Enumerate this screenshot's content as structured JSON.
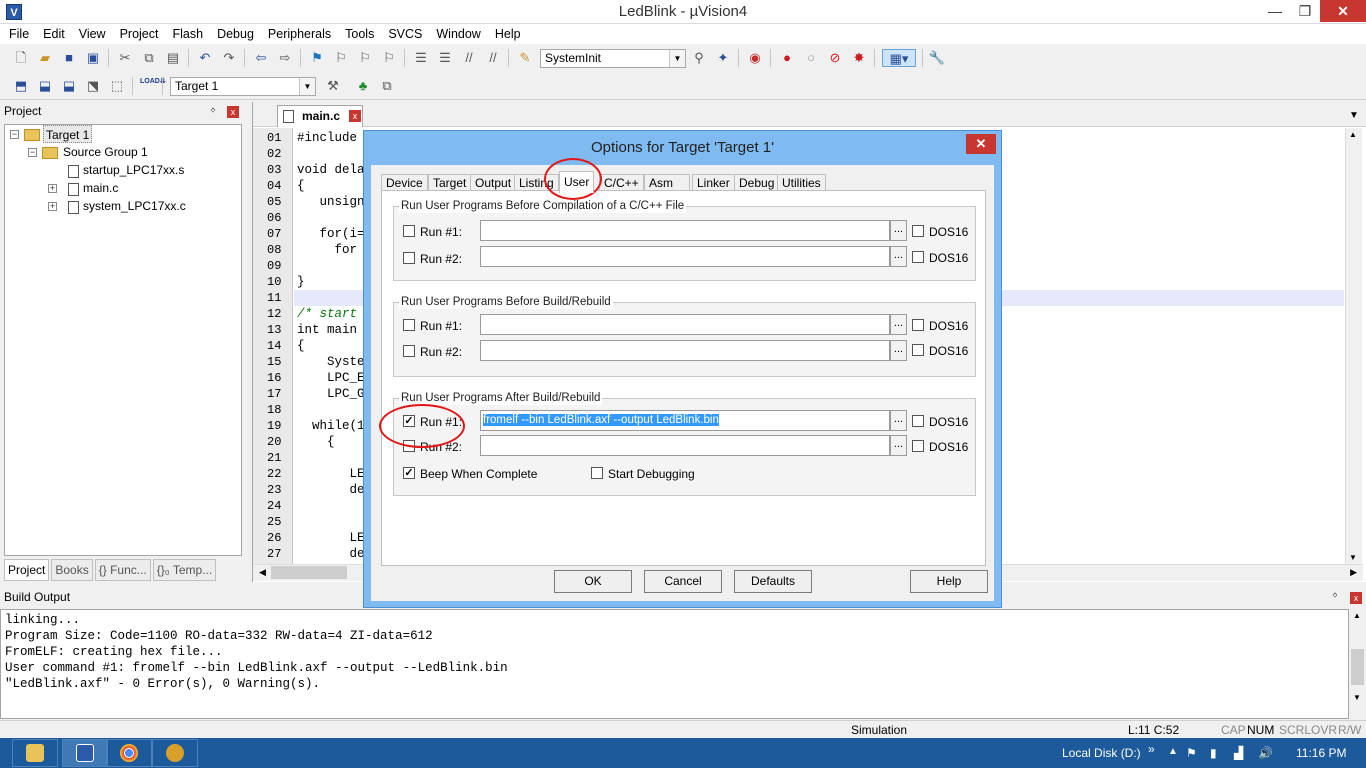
{
  "window": {
    "title": "LedBlink  - µVision4",
    "min": "—",
    "max": "❐",
    "close": "✕"
  },
  "menu": [
    "File",
    "Edit",
    "View",
    "Project",
    "Flash",
    "Debug",
    "Peripherals",
    "Tools",
    "SVCS",
    "Window",
    "Help"
  ],
  "toolbar": {
    "function_combo": "SystemInit",
    "target_combo": "Target 1",
    "load_label": "LOAD"
  },
  "project_panel": {
    "title": "Project",
    "pin": "ᛜ",
    "close": "x",
    "tree": {
      "target": "Target 1",
      "group": "Source Group 1",
      "files": [
        "startup_LPC17xx.s",
        "main.c",
        "system_LPC17xx.c"
      ]
    },
    "tabs": [
      "Project",
      "Books",
      "{} Func...",
      "{}₀ Temp..."
    ]
  },
  "editor": {
    "tab": "main.c",
    "tab_close": "x",
    "lines": [
      {
        "n": "01",
        "t": "#include"
      },
      {
        "n": "02",
        "t": ""
      },
      {
        "n": "03",
        "t": "void dela"
      },
      {
        "n": "04",
        "t": "{"
      },
      {
        "n": "05",
        "t": "   unsign"
      },
      {
        "n": "06",
        "t": ""
      },
      {
        "n": "07",
        "t": "   for(i="
      },
      {
        "n": "08",
        "t": "     for"
      },
      {
        "n": "09",
        "t": ""
      },
      {
        "n": "10",
        "t": "}"
      },
      {
        "n": "11",
        "t": ""
      },
      {
        "n": "12",
        "t": "/* start",
        "c": true
      },
      {
        "n": "13",
        "t": "int main"
      },
      {
        "n": "14",
        "t": "{"
      },
      {
        "n": "15",
        "t": "    Syste"
      },
      {
        "n": "16",
        "t": "    LPC_E"
      },
      {
        "n": "17",
        "t": "    LPC_G"
      },
      {
        "n": "18",
        "t": ""
      },
      {
        "n": "19",
        "t": "  while(1"
      },
      {
        "n": "20",
        "t": "    {"
      },
      {
        "n": "21",
        "t": ""
      },
      {
        "n": "22",
        "t": "       LE"
      },
      {
        "n": "23",
        "t": "       de"
      },
      {
        "n": "24",
        "t": ""
      },
      {
        "n": "25",
        "t": ""
      },
      {
        "n": "26",
        "t": "       LE"
      },
      {
        "n": "27",
        "t": "       de"
      }
    ]
  },
  "build_output": {
    "title": "Build Output",
    "lines": [
      "linking...",
      "Program Size: Code=1100 RO-data=332 RW-data=4 ZI-data=612",
      "FromELF: creating hex file...",
      "User command #1: fromelf --bin LedBlink.axf --output --LedBlink.bin",
      "\"LedBlink.axf\" - 0 Error(s), 0 Warning(s)."
    ]
  },
  "statusbar": {
    "mode": "Simulation",
    "position": "L:11 C:52",
    "caps": "CAP",
    "num": "NUM",
    "scrl": "SCRL",
    "ovr": "OVR",
    "rw": "R/W"
  },
  "taskbar": {
    "location": "Local Disk (D:)",
    "chevron": "»",
    "clock": "11:16 PM"
  },
  "dialog": {
    "title": "Options for Target 'Target 1'",
    "close": "✕",
    "tabs": [
      "Device",
      "Target",
      "Output",
      "Listing",
      "User",
      "C/C++",
      "Asm",
      "Linker",
      "Debug",
      "Utilities"
    ],
    "active_tab": "User",
    "group1": {
      "title": "Run User Programs Before Compilation of a C/C++ File",
      "run1": {
        "label": "Run #1:",
        "value": "",
        "checked": false,
        "dos16": "DOS16"
      },
      "run2": {
        "label": "Run #2:",
        "value": "",
        "checked": false,
        "dos16": "DOS16"
      }
    },
    "group2": {
      "title": "Run User Programs Before Build/Rebuild",
      "run1": {
        "label": "Run #1:",
        "value": "",
        "checked": false,
        "dos16": "DOS16"
      },
      "run2": {
        "label": "Run #2:",
        "value": "",
        "checked": false,
        "dos16": "DOS16"
      }
    },
    "group3": {
      "title": "Run User Programs After Build/Rebuild",
      "run1": {
        "label": "Run #1:",
        "value": "fromelf --bin LedBlink.axf --output  LedBlink.bin",
        "checked": true,
        "dos16": "DOS16"
      },
      "run2": {
        "label": "Run #2:",
        "value": "",
        "checked": false,
        "dos16": "DOS16"
      },
      "beep": {
        "label": "Beep When Complete",
        "checked": true
      },
      "start_debug": {
        "label": "Start Debugging",
        "checked": false
      }
    },
    "browse": "...",
    "buttons": {
      "ok": "OK",
      "cancel": "Cancel",
      "defaults": "Defaults",
      "help": "Help"
    }
  },
  "colors": {
    "accent": "#2a5aa8",
    "taskbar": "#1c5a9b",
    "annotation": "#e01818",
    "selection": "#3399ff"
  }
}
